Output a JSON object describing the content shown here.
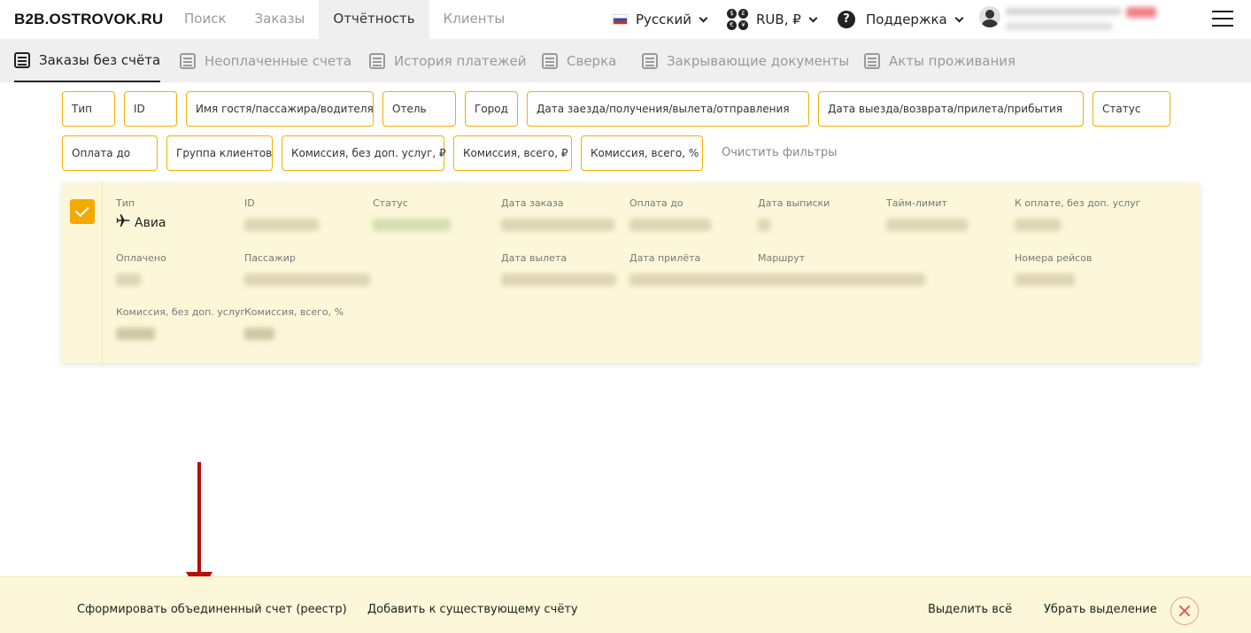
{
  "header": {
    "logo": "B2B.OSTROVOK.RU",
    "nav": [
      "Поиск",
      "Заказы",
      "Отчётность",
      "Клиенты"
    ],
    "active_nav": "Отчётность",
    "language": "Русский",
    "currency": "RUB, ₽",
    "support": "Поддержка"
  },
  "subnav": {
    "items": [
      "Заказы без счёта",
      "Неоплаченные счета",
      "История платежей",
      "Сверка",
      "Закрывающие документы",
      "Акты проживания"
    ],
    "active": "Заказы без счёта"
  },
  "filters": {
    "row1": [
      "Тип",
      "ID",
      "Имя гостя/пассажира/водителя",
      "Отель",
      "Город",
      "Дата заезда/получения/вылета/отправления",
      "Дата выезда/возврата/прилета/прибытия",
      "Статус"
    ],
    "row2": [
      "Оплата до",
      "Группа клиентов",
      "Комиссия, без доп. услуг, ₽",
      "Комиссия, всего, ₽",
      "Комиссия, всего, %"
    ],
    "clear": "Очистить фильтры"
  },
  "order": {
    "checked": true,
    "labels": {
      "type": "Тип",
      "id": "ID",
      "status": "Статус",
      "order_date": "Дата заказа",
      "pay_until": "Оплата до",
      "statement_date": "Дата выписки",
      "time_limit": "Тайм-лимит",
      "to_pay": "К оплате, без доп. услуг",
      "paid": "Оплачено",
      "passenger": "Пассажир",
      "departure": "Дата вылета",
      "arrival": "Дата прилёта",
      "route": "Маршрут",
      "flights": "Номера рейсов",
      "commission_no_extra": "Комиссия, без доп. услуг",
      "commission_pct": "Комиссия, всего, %"
    },
    "type_value": "Авиа",
    "type_icon": "plane-icon"
  },
  "bottom": {
    "create_invoice": "Сформировать объединенный счет (реестр)",
    "add_to_invoice": "Добавить к существующему счёту",
    "select_all": "Выделить всё",
    "deselect": "Убрать выделение"
  },
  "colors": {
    "accent": "#f4a900",
    "card_bg": "#fdf7d9",
    "arrow": "#b50d0d",
    "close": "#e05a5a"
  }
}
